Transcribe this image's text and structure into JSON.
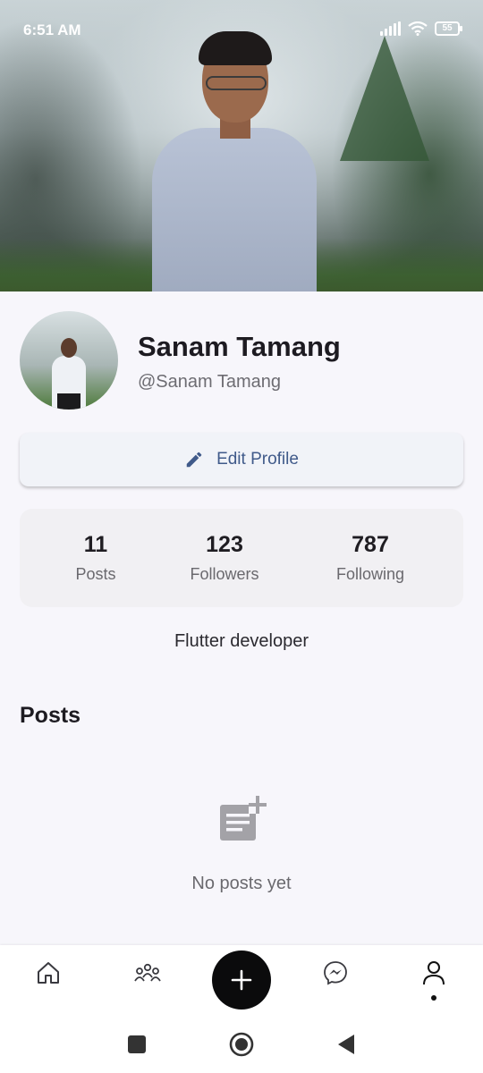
{
  "status_bar": {
    "time": "6:51 AM",
    "battery": "55"
  },
  "profile": {
    "name": "Sanam Tamang",
    "handle": "@Sanam Tamang",
    "edit_button_label": "Edit Profile",
    "bio": "Flutter developer"
  },
  "stats": [
    {
      "value": "11",
      "label": "Posts"
    },
    {
      "value": "123",
      "label": "Followers"
    },
    {
      "value": "787",
      "label": "Following"
    }
  ],
  "posts_section": {
    "title": "Posts",
    "empty_message": "No posts yet"
  },
  "bottom_nav": {
    "items": [
      {
        "icon": "home-icon"
      },
      {
        "icon": "community-icon"
      },
      {
        "icon": "plus-icon"
      },
      {
        "icon": "messenger-icon"
      },
      {
        "icon": "profile-icon",
        "active": true
      }
    ]
  },
  "colors": {
    "accent": "#405a8a",
    "fab": "#0b0b0c",
    "background": "#f7f6fb"
  }
}
